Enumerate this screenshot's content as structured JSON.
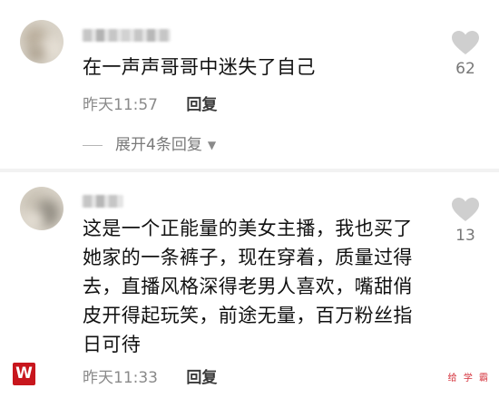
{
  "comments": [
    {
      "text": "在一声声哥哥中迷失了自己",
      "time": "昨天11:57",
      "reply_label": "回复",
      "likes": "62",
      "expand_label": "展开4条回复"
    },
    {
      "text": "这是一个正能量的美女主播，我也买了她家的一条裤子，现在穿着，质量过得去，直播风格深得老男人喜欢，嘴甜俏皮开得起玩笑，前途无量，百万粉丝指日可待",
      "time": "昨天11:33",
      "reply_label": "回复",
      "likes": "13"
    }
  ],
  "icons": {
    "like": "heart-icon",
    "expand": "caret-down-icon",
    "logo": "w-logo-icon"
  },
  "colors": {
    "text": "#111111",
    "secondary": "#8a8a8a",
    "heart": "#cfcfcf",
    "logo": "#c8161d",
    "watermark": "#d4303a"
  },
  "logo_glyph": "W",
  "watermark_text": "给 学 霸"
}
